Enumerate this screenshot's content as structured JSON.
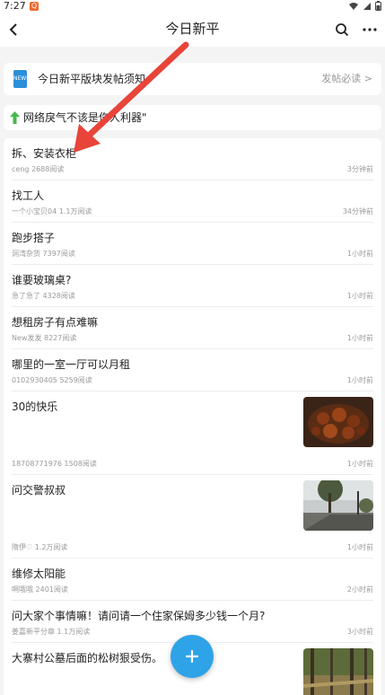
{
  "status_bar": {
    "time": "7:27",
    "notif_badge": "Q"
  },
  "app_bar": {
    "title": "今日新平"
  },
  "notice": {
    "icon_label": "NEWS",
    "title": "今日新平版块发帖须知",
    "link": "发帖必读 >"
  },
  "rule": {
    "text": "网络戾气不该是伤人利器\""
  },
  "posts": [
    {
      "title": "拆、安装衣柜",
      "meta": "ceng 2688阅读",
      "time": "3分钟前"
    },
    {
      "title": "找工人",
      "meta": "一个小宝贝04 1.1万阅读",
      "time": "34分钟前"
    },
    {
      "title": "跑步搭子",
      "meta": "洞湾杂货 7397阅读",
      "time": "1小时前"
    },
    {
      "title": "谁要玻璃桌?",
      "meta": "急了急了 4328阅读",
      "time": "1小时前"
    },
    {
      "title": "想租房子有点难嘛",
      "meta": "New发发 8227阅读",
      "time": "1小时前"
    },
    {
      "title": "哪里的一室一厅可以月租",
      "meta": "0102930405 5259阅读",
      "time": "1小时前"
    },
    {
      "title": "30的快乐",
      "meta": "18708771976 1508阅读",
      "time": "1小时前",
      "thumb": "food"
    },
    {
      "title": "问交警叔叔",
      "meta": "隋伊♡ 1.2万阅读",
      "time": "1小时前",
      "thumb": "street"
    },
    {
      "title": "维修太阳能",
      "meta": "啊哦哦 2401阅读",
      "time": "2小时前"
    },
    {
      "title": "问大家个事情嘛！请问请一个住家保姆多少钱一个月?",
      "meta": "姜嘉新平分章 1.1万阅读",
      "time": "3小时前"
    },
    {
      "title": "大寨村公墓后面的松树狠受伤。",
      "meta": "",
      "time": "",
      "thumb": "forest"
    }
  ],
  "colors": {
    "accent": "#2fa3e8",
    "annotation_arrow": "#e8443a",
    "notif": "#ef6a2e"
  }
}
